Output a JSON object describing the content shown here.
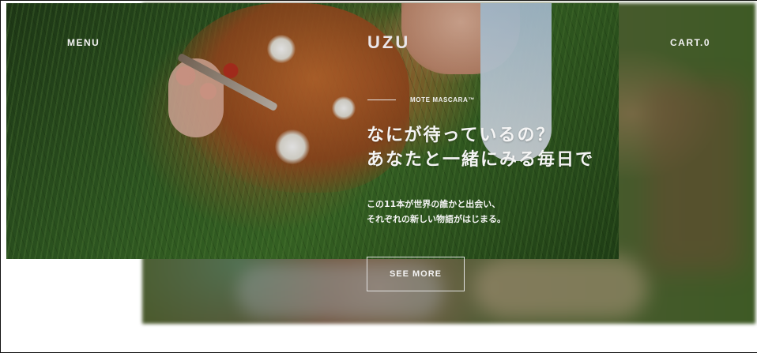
{
  "header": {
    "menu_label": "MENU",
    "logo_text": "UZU",
    "cart_label": "CART.0"
  },
  "hero": {
    "product_label": "MOTE MASCARA™",
    "headline_line1": "なにが待っているの？",
    "headline_line2": "あなたと一緒にみる毎日で",
    "subtext_line1": "この11本が世界の誰かと出会い、",
    "subtext_line2": "それぞれの新しい物語がはじまる。",
    "cta_label": "SEE MORE"
  }
}
